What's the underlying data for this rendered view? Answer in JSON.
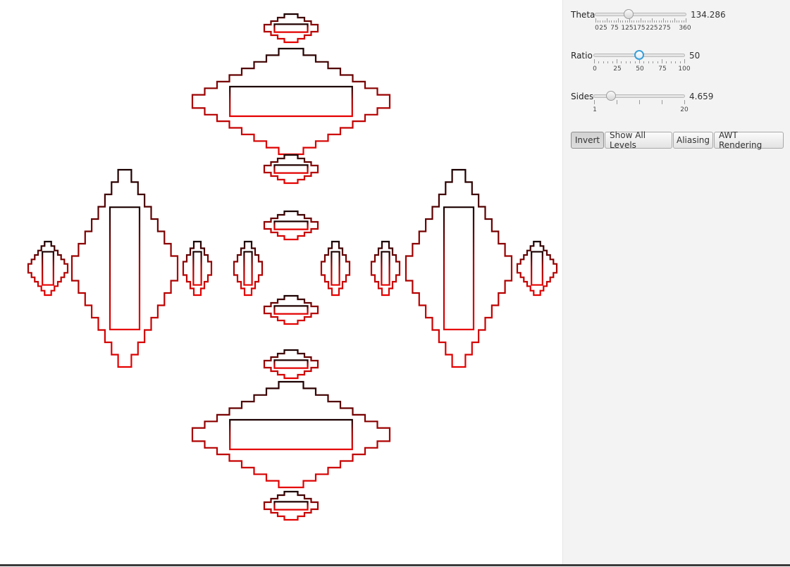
{
  "sliders": {
    "theta": {
      "label": "Theta",
      "value": "134.286",
      "fraction": 0.373,
      "tick_labels": [
        "0",
        "25",
        "75",
        "125",
        "175",
        "225",
        "275",
        "360"
      ]
    },
    "ratio": {
      "label": "Ratio",
      "value": "50",
      "fraction": 0.5,
      "tick_labels": [
        "0",
        "25",
        "50",
        "75",
        "100"
      ]
    },
    "sides": {
      "label": "Sides",
      "value": "4.659",
      "fraction": 0.193,
      "tick_labels": [
        "1",
        "20"
      ]
    }
  },
  "buttons": {
    "invert": "Invert",
    "show_all_levels": "Show All Levels",
    "aliasing": "Aliasing",
    "awt_rendering": "AWT Rendering"
  },
  "colors": {
    "fractal_dark": "#1a0000",
    "fractal_bright": "#e60000",
    "slider_focus": "#3a9fd8"
  }
}
